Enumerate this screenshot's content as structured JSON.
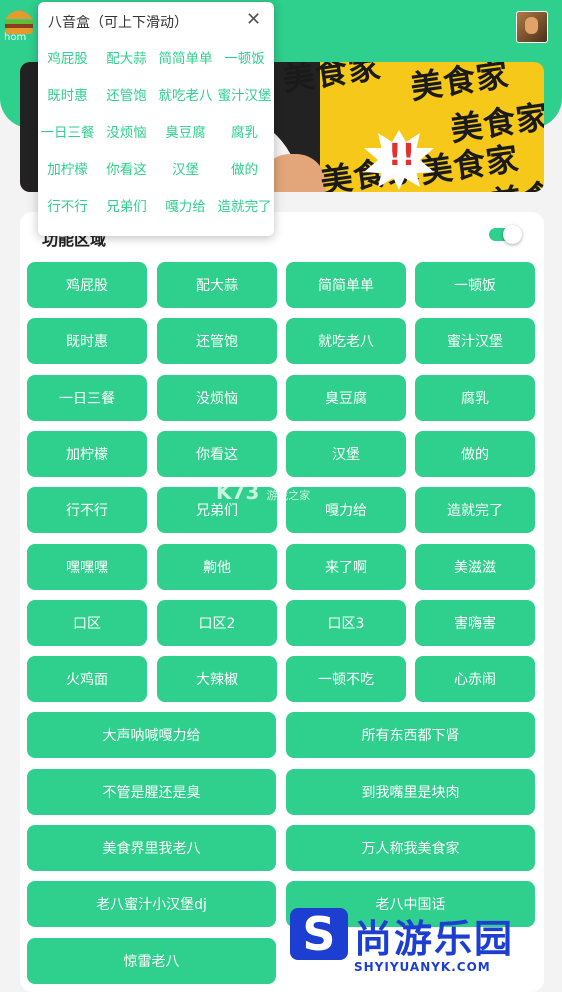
{
  "app": {
    "logo_label": "hom"
  },
  "section": {
    "title": "功能区域"
  },
  "buttons": [
    "鸡屁股",
    "配大蒜",
    "简简单单",
    "一顿饭",
    "既时惠",
    "还管饱",
    "就吃老八",
    "蜜汁汉堡",
    "一日三餐",
    "没烦恼",
    "臭豆腐",
    "腐乳",
    "加柠檬",
    "你看这",
    "汉堡",
    "做的",
    "行不行",
    "兄弟们",
    "嘎力给",
    "造就完了",
    "嘿嘿嘿",
    "齁他",
    "来了啊",
    "美滋滋",
    "口区",
    "口区2",
    "口区3",
    "害嗨害",
    "火鸡面",
    "大辣椒",
    "一顿不吃",
    "心赤闹",
    "大声呐喊嘎力给",
    "所有东西都下肾",
    "不管是腥还是臭",
    "到我嘴里是块肉",
    "美食界里我老八",
    "万人称我美食家",
    "老八蜜汁小汉堡dj",
    "老八中国话",
    "惊雷老八"
  ],
  "popup": {
    "title": "八音盒（可上下滑动）",
    "close": "✕",
    "items": [
      "鸡屁股",
      "配大蒜",
      "简简单单",
      "一顿饭",
      "既时惠",
      "还管饱",
      "就吃老八",
      "蜜汁汉堡",
      "一日三餐",
      "没烦恼",
      "臭豆腐",
      "腐乳",
      "加柠檬",
      "你看这",
      "汉堡",
      "做的",
      "行不行",
      "兄弟们",
      "嘎力给",
      "造就完了"
    ]
  },
  "banner": {
    "words": [
      "美食家",
      "美食家",
      "美食家",
      "美食家",
      "美食家",
      "美食家"
    ],
    "exclaim": "!!"
  },
  "watermark": {
    "center": "K73",
    "center_sub": "游戏之家",
    "brand": "尚游乐园",
    "brand_logo": "S",
    "brand_url": "SHYIYUANYK.COM"
  },
  "colors": {
    "accent": "#2fcf8d",
    "banner": "#f5c81a"
  }
}
